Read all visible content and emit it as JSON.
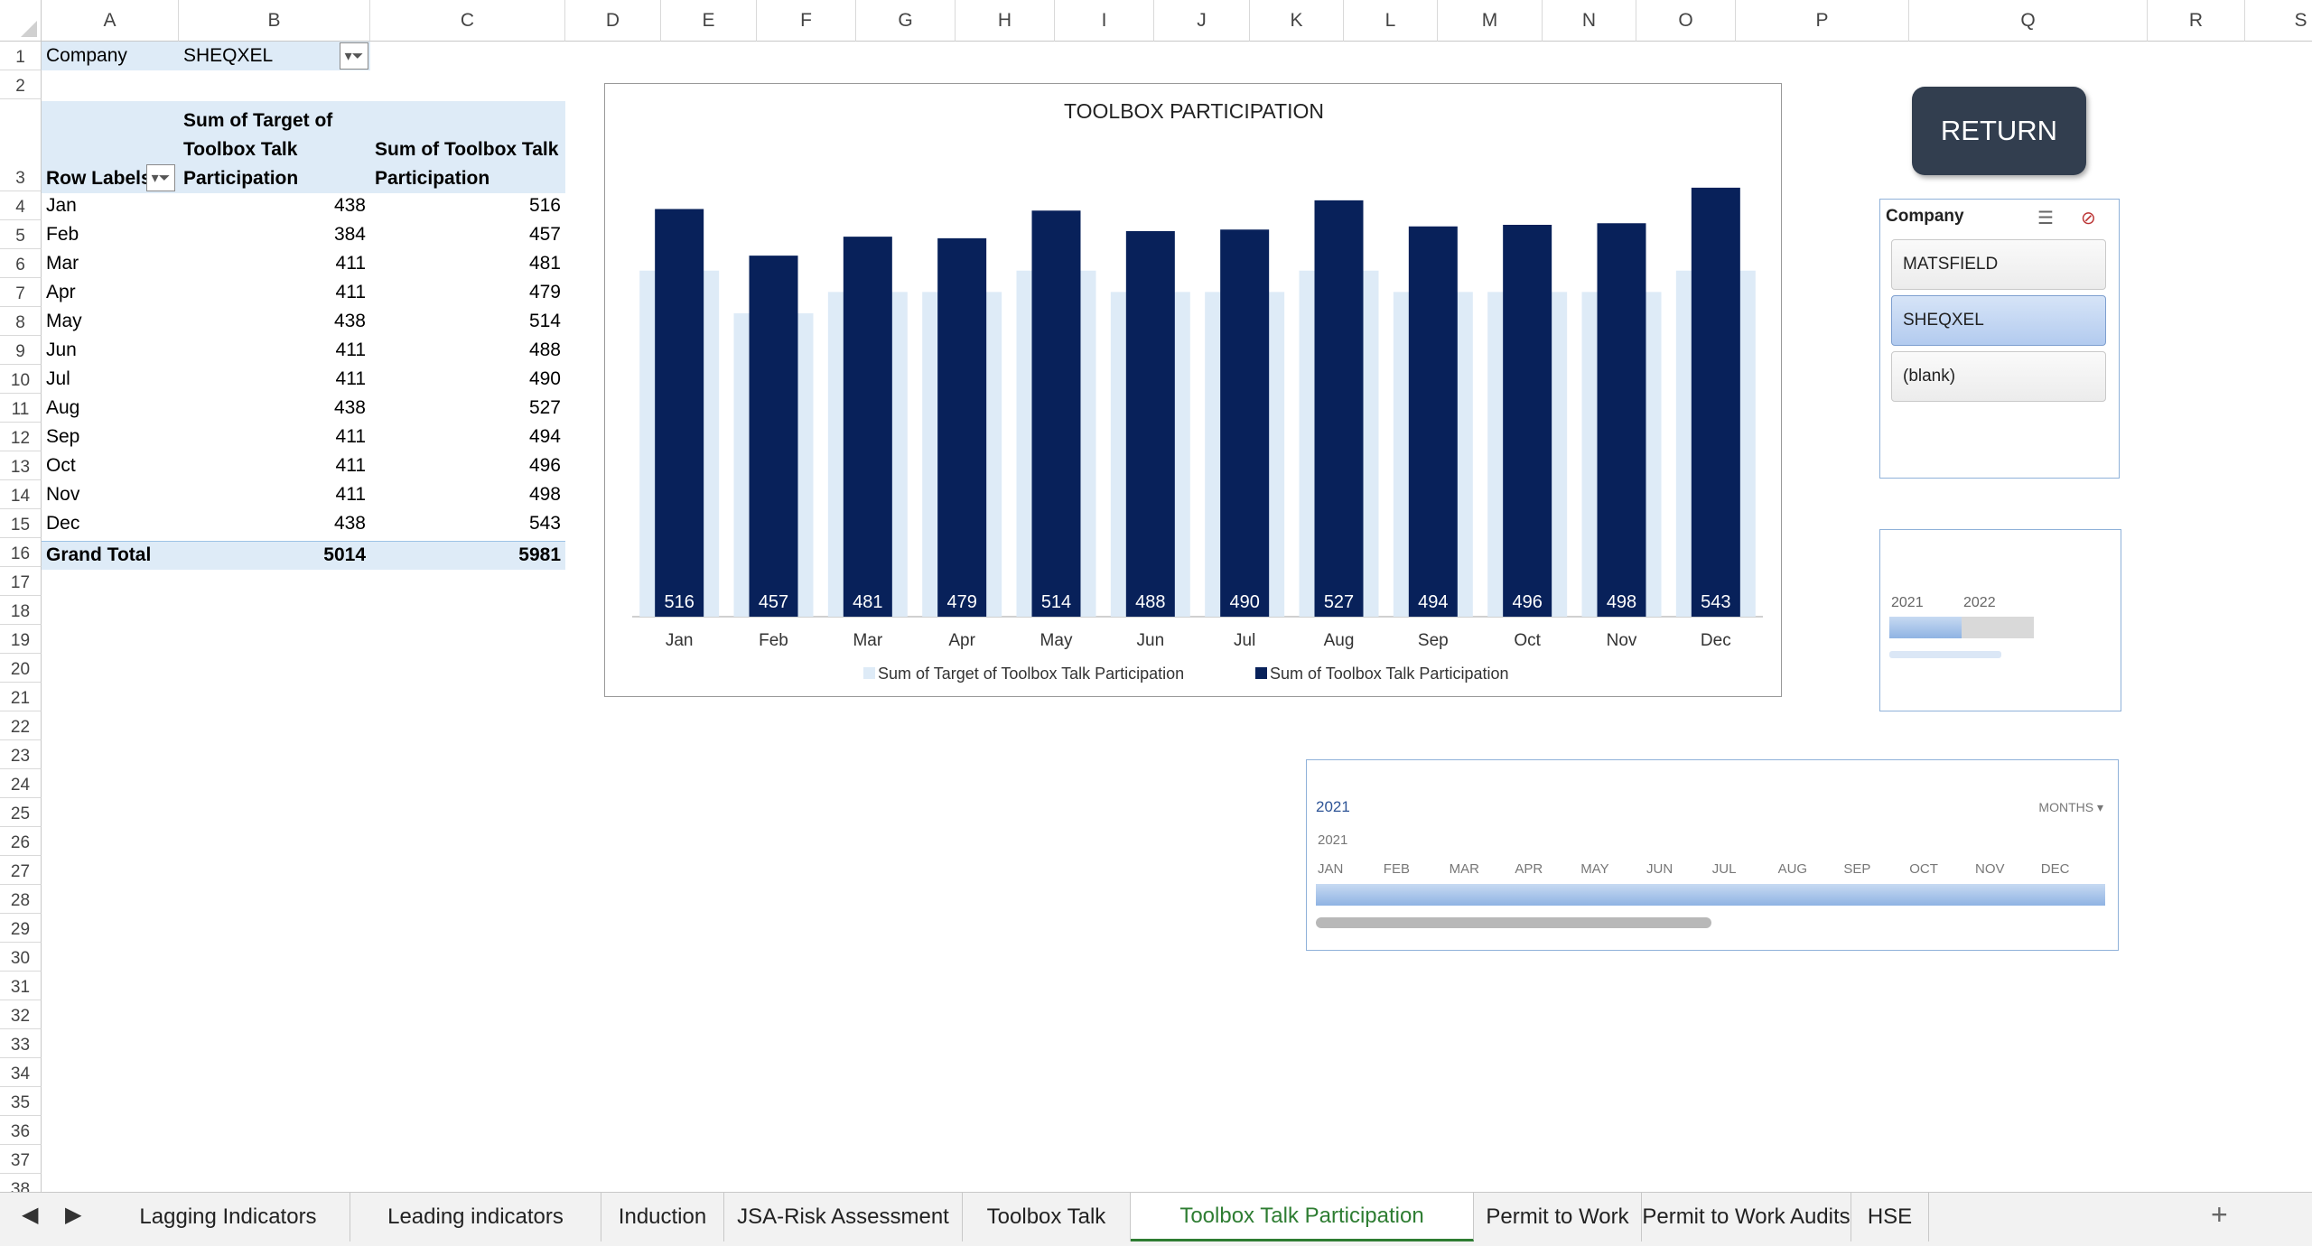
{
  "columns": [
    "A",
    "B",
    "C",
    "D",
    "E",
    "F",
    "G",
    "H",
    "I",
    "J",
    "K",
    "L",
    "M",
    "N",
    "O",
    "P",
    "Q",
    "R",
    "S"
  ],
  "rows": [
    "1",
    "2",
    "3",
    "4",
    "5",
    "6",
    "7",
    "8",
    "9",
    "10",
    "11",
    "12",
    "13",
    "14",
    "15",
    "16",
    "17",
    "18",
    "19",
    "20",
    "21",
    "22",
    "23",
    "24",
    "25",
    "26",
    "27",
    "28",
    "29",
    "30",
    "31",
    "32",
    "33",
    "34",
    "35",
    "36",
    "37",
    "38"
  ],
  "filter": {
    "label": "Company",
    "value": "SHEQXEL"
  },
  "pivot": {
    "row_labels_header": "Row Labels",
    "col_b_header": [
      "Sum of Target of",
      "Toolbox Talk",
      "Participation"
    ],
    "col_c_header": [
      "Sum of Toolbox Talk",
      "Participation"
    ],
    "rows": [
      {
        "label": "Jan",
        "target": "438",
        "actual": "516"
      },
      {
        "label": "Feb",
        "target": "384",
        "actual": "457"
      },
      {
        "label": "Mar",
        "target": "411",
        "actual": "481"
      },
      {
        "label": "Apr",
        "target": "411",
        "actual": "479"
      },
      {
        "label": "May",
        "target": "438",
        "actual": "514"
      },
      {
        "label": "Jun",
        "target": "411",
        "actual": "488"
      },
      {
        "label": "Jul",
        "target": "411",
        "actual": "490"
      },
      {
        "label": "Aug",
        "target": "438",
        "actual": "527"
      },
      {
        "label": "Sep",
        "target": "411",
        "actual": "494"
      },
      {
        "label": "Oct",
        "target": "411",
        "actual": "496"
      },
      {
        "label": "Nov",
        "target": "411",
        "actual": "498"
      },
      {
        "label": "Dec",
        "target": "438",
        "actual": "543"
      }
    ],
    "grand_total": {
      "label": "Grand Total",
      "target": "5014",
      "actual": "5981"
    }
  },
  "chart_data": {
    "type": "bar",
    "title": "TOOLBOX PARTICIPATION",
    "categories": [
      "Jan",
      "Feb",
      "Mar",
      "Apr",
      "May",
      "Jun",
      "Jul",
      "Aug",
      "Sep",
      "Oct",
      "Nov",
      "Dec"
    ],
    "series": [
      {
        "name": "Sum of Target of Toolbox Talk Participation",
        "values": [
          438,
          384,
          411,
          411,
          438,
          411,
          411,
          438,
          411,
          411,
          411,
          438
        ],
        "color": "#deebf7"
      },
      {
        "name": "Sum of Toolbox Talk Participation",
        "values": [
          516,
          457,
          481,
          479,
          514,
          488,
          490,
          527,
          494,
          496,
          498,
          543
        ],
        "color": "#08215a"
      }
    ],
    "ylim": [
      0,
      560
    ],
    "grid": false,
    "legend": "bottom"
  },
  "return_button": {
    "label": "RETURN"
  },
  "slicer": {
    "title": "Company",
    "items": [
      {
        "label": "MATSFIELD",
        "selected": false
      },
      {
        "label": "SHEQXEL",
        "selected": true
      },
      {
        "label": "(blank)",
        "selected": false
      }
    ]
  },
  "timeline_small": {
    "years": [
      "2021",
      "2022"
    ]
  },
  "timeline_big": {
    "header": "2021",
    "level": "MONTHS",
    "year_label": "2021",
    "months": [
      "JAN",
      "FEB",
      "MAR",
      "APR",
      "MAY",
      "JUN",
      "JUL",
      "AUG",
      "SEP",
      "OCT",
      "NOV",
      "DEC"
    ]
  },
  "tabs": [
    {
      "label": "Lagging Indicators",
      "active": false
    },
    {
      "label": "Leading indicators",
      "active": false
    },
    {
      "label": "Induction",
      "active": false
    },
    {
      "label": "JSA-Risk Assessment",
      "active": false
    },
    {
      "label": "Toolbox Talk",
      "active": false
    },
    {
      "label": "Toolbox Talk Participation",
      "active": true
    },
    {
      "label": "Permit to Work",
      "active": false
    },
    {
      "label": "Permit to Work Audits",
      "active": false
    },
    {
      "label": "HSE",
      "active": false
    }
  ],
  "add_sheet": "+"
}
